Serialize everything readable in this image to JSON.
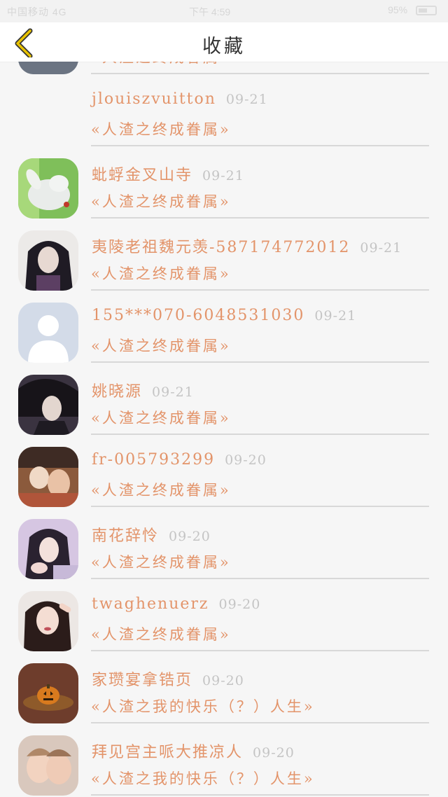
{
  "status_bar": {
    "left": "中国移动 4G",
    "center": "下午 4:59",
    "right": "95%"
  },
  "header": {
    "title": "收藏"
  },
  "colors": {
    "accent": "#e3946a",
    "date": "#c4c4c4",
    "back_arrow": "#e8c200"
  },
  "items": [
    {
      "name": "",
      "date": "",
      "book": "«人渣之终成眷属»",
      "avatar": "partial-top"
    },
    {
      "name": "jlouiszvuitton",
      "date": "09-21",
      "book": "«人渣之终成眷属»",
      "avatar": "none"
    },
    {
      "name": "蚍蜉金叉山寺",
      "date": "09-21",
      "book": "«人渣之终成眷属»",
      "avatar": "white-rabbit"
    },
    {
      "name": "夷陵老祖魏元羡-58717477201​2",
      "date": "09-21",
      "book": "«人渣之终成眷属»",
      "avatar": "anime-dark-hair"
    },
    {
      "name": "155***070-6048531030",
      "date": "09-21",
      "book": "«人渣之终成眷属»",
      "avatar": "default-user"
    },
    {
      "name": "姚晓源",
      "date": "09-21",
      "book": "«人渣之终成眷属»",
      "avatar": "anime-boy"
    },
    {
      "name": "fr-005793299",
      "date": "09-20",
      "book": "«人渣之终成眷属»",
      "avatar": "anime-couple"
    },
    {
      "name": "南花辞怜",
      "date": "09-20",
      "book": "«人渣之终成眷属»",
      "avatar": "anime-girl"
    },
    {
      "name": "twaghenuerz",
      "date": "09-20",
      "book": "«人渣之终成眷属»",
      "avatar": "girl-photo"
    },
    {
      "name": "家瓒宴拿锆页",
      "date": "09-20",
      "book": "«人渣之我的快乐（？）人生»",
      "avatar": "pumpkin"
    },
    {
      "name": "拜见宫主哌大推凉人",
      "date": "09-20",
      "book": "«人渣之我的快乐（？）人生»",
      "avatar": "kids-photo"
    }
  ]
}
